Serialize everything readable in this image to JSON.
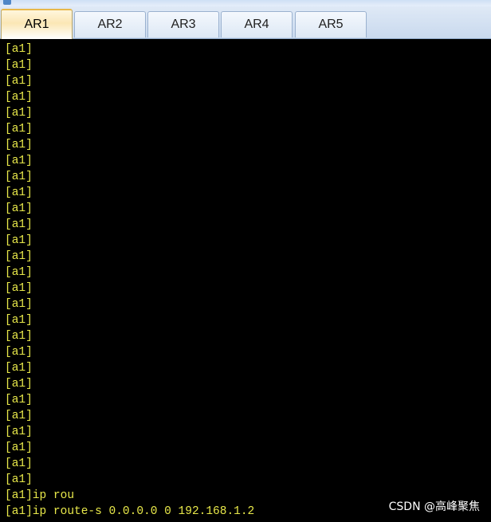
{
  "window": {
    "title": ""
  },
  "tabs": [
    {
      "label": "AR1",
      "active": true
    },
    {
      "label": "AR2",
      "active": false
    },
    {
      "label": "AR3",
      "active": false
    },
    {
      "label": "AR4",
      "active": false
    },
    {
      "label": "AR5",
      "active": false
    }
  ],
  "terminal": {
    "text_color": "#e8e84a",
    "background_color": "#000000",
    "lines": [
      "[a1]",
      "[a1]",
      "[a1]",
      "[a1]",
      "[a1]",
      "[a1]",
      "[a1]",
      "[a1]",
      "[a1]",
      "[a1]",
      "[a1]",
      "[a1]",
      "[a1]",
      "[a1]",
      "[a1]",
      "[a1]",
      "[a1]",
      "[a1]",
      "[a1]",
      "[a1]",
      "[a1]",
      "[a1]",
      "[a1]",
      "[a1]",
      "[a1]",
      "[a1]",
      "[a1]",
      "[a1]",
      "[a1]ip rou",
      "[a1]ip route-s 0.0.0.0 0 192.168.1.2"
    ]
  },
  "watermark": {
    "text": "CSDN @高峰聚焦"
  }
}
